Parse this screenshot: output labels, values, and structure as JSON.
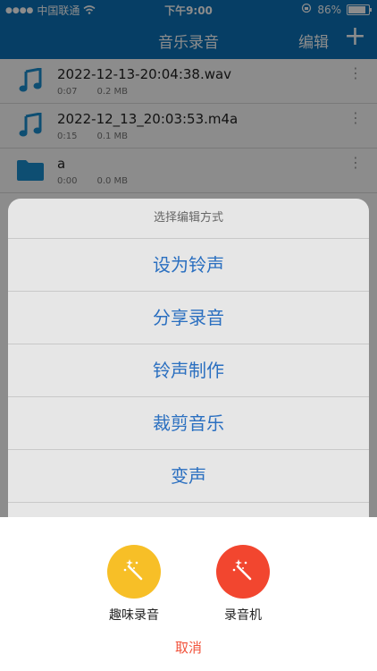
{
  "status_bar": {
    "carrier": "中国联通",
    "time": "下午9:00",
    "battery": "86%",
    "battery_level": 0.86
  },
  "nav": {
    "title": "音乐录音",
    "edit_label": "编辑",
    "add_label": "+"
  },
  "files": [
    {
      "name": "2022-12-13-20:04:38.wav",
      "duration": "0:07",
      "size": "0.2 MB",
      "icon": "music-note-icon"
    },
    {
      "name": "2022-12_13_20:03:53.m4a",
      "duration": "0:15",
      "size": "0.1 MB",
      "icon": "music-note-icon"
    },
    {
      "name": "a",
      "duration": "0:00",
      "size": "0.0 MB",
      "icon": "folder-icon"
    }
  ],
  "sheet": {
    "title": "选择编辑方式",
    "options": [
      "设为铃声",
      "分享录音",
      "铃声制作",
      "裁剪音乐",
      "变声"
    ]
  },
  "bottom": {
    "fun_record_label": "趣味录音",
    "recorder_label": "录音机",
    "cancel_label": "取消"
  },
  "colors": {
    "accent": "#0b72b8",
    "link_blue": "#2a6fc0",
    "yellow": "#f7bf27",
    "red": "#f2462f",
    "cancel": "#f1523b"
  }
}
